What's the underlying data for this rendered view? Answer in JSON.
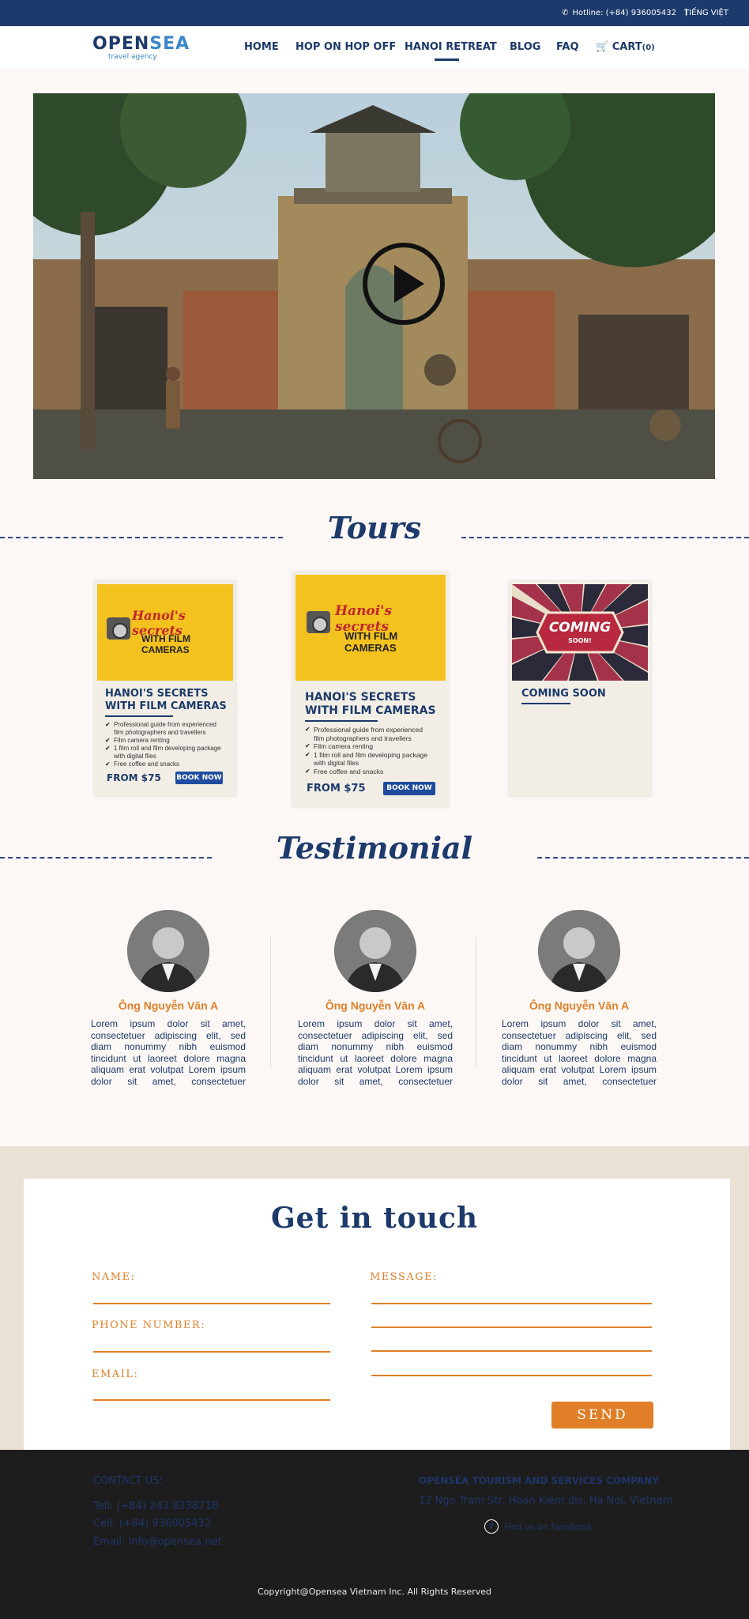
{
  "topbar": {
    "hotline": "Hotline: (+84) 936005432",
    "separator": "|",
    "language": "TIẾNG VIỆT"
  },
  "brand": {
    "name_part1": "OPEN",
    "name_part2": "SEA",
    "tagline": "travel agency"
  },
  "nav": {
    "home": "HOME",
    "hop": "HOP ON HOP OFF",
    "retreat": "HANOI RETREAT",
    "blog": "BLOG",
    "faq": "FAQ",
    "cart": "CART",
    "cart_count": "(0)"
  },
  "sections": {
    "tours": "Tours",
    "testimonial": "Testimonial"
  },
  "tours": [
    {
      "script": "Hanoi's secrets",
      "sub": "WITH FILM CAMERAS",
      "title_line1": "HANOI'S SECRETS",
      "title_line2": "WITH FILM CAMERAS",
      "bullets": [
        "Professional guide from experienced",
        "film photographers and travellers",
        "Film camera renting",
        "1 film roll and film developing package",
        "with digital files",
        "Free coffee and snacks"
      ],
      "price": "FROM $75",
      "book": "BOOK NOW"
    },
    {
      "script": "Hanoi's secrets",
      "sub": "WITH FILM CAMERAS",
      "title_line1": "HANOI'S SECRETS",
      "title_line2": "WITH FILM CAMERAS",
      "bullets": [
        "Professional guide from experienced",
        "film photographers and travellers",
        "Film camera renting",
        "1 film roll and film developing package",
        "with digital files",
        "Free coffee and snacks"
      ],
      "price": "FROM $75",
      "book": "BOOK NOW"
    },
    {
      "badge_main": "COMING",
      "badge_sub": "SOON!",
      "title": "COMING SOON"
    }
  ],
  "testimonials": [
    {
      "name": "Ông Nguyễn Văn A",
      "text": "Lorem ipsum dolor sit amet, consectetuer adipiscing elit, sed diam nonummy nibh euismod tincidunt ut laoreet dolore magna aliquam erat volutpat Lorem ipsum dolor sit amet, consectetuer adipiscing elit, sed"
    },
    {
      "name": "Ông Nguyễn Văn A",
      "text": "Lorem ipsum dolor sit amet, consectetuer adipiscing elit, sed diam nonummy nibh euismod tincidunt ut laoreet dolore magna aliquam erat volutpat Lorem ipsum dolor sit amet, consectetuer adipiscing elit, sed"
    },
    {
      "name": "Ông Nguyễn Văn A",
      "text": "Lorem ipsum dolor sit amet, consectetuer adipiscing elit, sed diam nonummy nibh euismod tincidunt ut laoreet dolore magna aliquam erat volutpat Lorem ipsum dolor sit amet, consectetuer adipiscing elit, sed"
    }
  ],
  "contact": {
    "title": "Get in touch",
    "name_label": "NAME:",
    "phone_label": "PHONE NUMBER:",
    "email_label": "EMAIL:",
    "message_label": "MESSAGE:",
    "send": "SEND"
  },
  "footer": {
    "contact_heading": "CONTACT US:",
    "tel": "Tell: (+84) 243 8238718",
    "cell": "Cell: (+84) 936005432",
    "email": "Email: info@opensea.net",
    "company": "OPENSEA TOURISM AND SERVICES COMPANY",
    "address": "12 Ngo Tram Str, Hoan Kiem dis, Ha Noi, Vietnam",
    "facebook": "Find us on Facebook",
    "copyright": "Copyright@Opensea Vietnam Inc. All Rights Reserved"
  },
  "colors": {
    "navy": "#1c3a6b",
    "orange": "#e07f27",
    "button_blue": "#1f4c9e",
    "footer_bg": "#1d1d1e",
    "tour_yellow": "#f4c21f"
  }
}
